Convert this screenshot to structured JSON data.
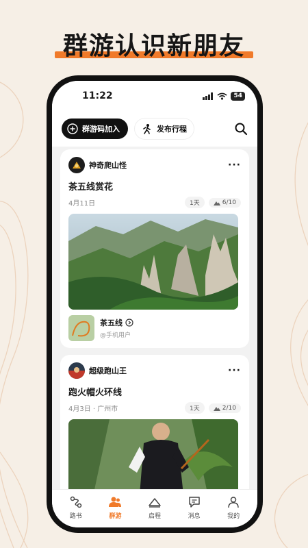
{
  "headline": "群游认识新朋友",
  "colors": {
    "accent": "#f07a2a",
    "dark": "#111111",
    "bg": "#f6efe6"
  },
  "status": {
    "time": "11:22",
    "battery": "54"
  },
  "topbar": {
    "join_label": "群游码加入",
    "publish_label": "发布行程",
    "search_icon": "search-icon"
  },
  "posts": [
    {
      "author": "神奇爬山怪",
      "title": "茶五线赏花",
      "date": "4月11日",
      "duration": "1天",
      "members": "6/10",
      "route_name": "茶五线",
      "route_user": "@手机用户"
    },
    {
      "author": "超级跑山王",
      "title": "跑火帽火环线",
      "date": "4月3日 · 广州市",
      "duration": "1天",
      "members": "2/10"
    }
  ],
  "tabs": [
    {
      "label": "路书",
      "icon": "route-icon"
    },
    {
      "label": "群游",
      "icon": "group-icon",
      "active": true
    },
    {
      "label": "启程",
      "icon": "mountain-icon"
    },
    {
      "label": "消息",
      "icon": "message-icon"
    },
    {
      "label": "我的",
      "icon": "profile-icon"
    }
  ]
}
